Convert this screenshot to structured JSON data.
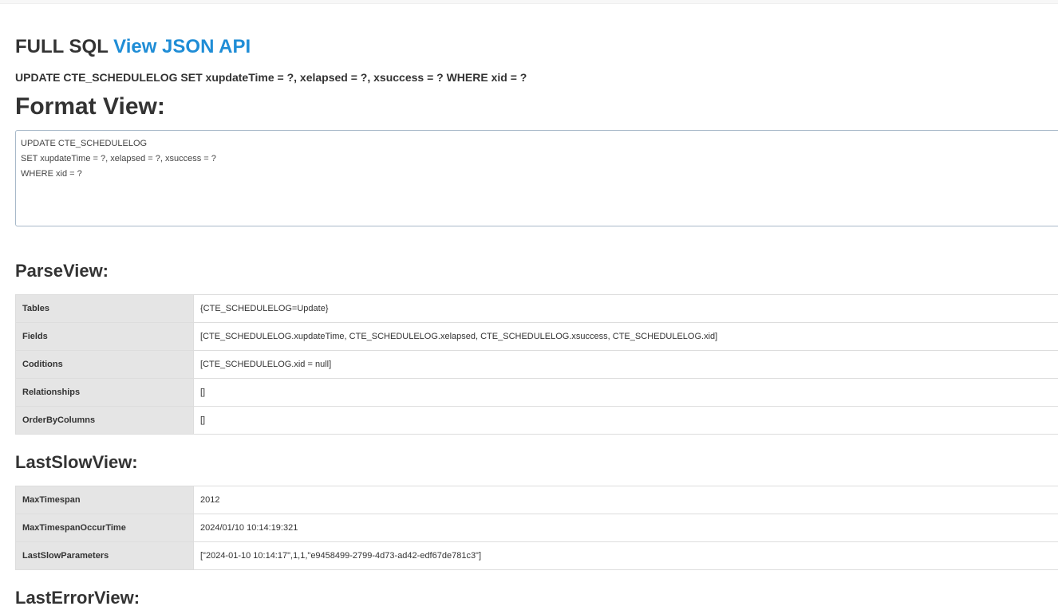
{
  "header": {
    "title": "FULL SQL",
    "json_link": "View JSON API",
    "sql": "UPDATE CTE_SCHEDULELOG SET xupdateTime = ?, xelapsed = ?, xsuccess = ? WHERE xid = ?"
  },
  "format_view": {
    "heading": "Format View:",
    "lines": [
      "UPDATE CTE_SCHEDULELOG",
      "SET xupdateTime = ?, xelapsed = ?, xsuccess = ?",
      "WHERE xid = ?"
    ]
  },
  "parse_view": {
    "heading": "ParseView:",
    "rows": [
      {
        "key": "Tables",
        "value": "{CTE_SCHEDULELOG=Update}"
      },
      {
        "key": "Fields",
        "value": "[CTE_SCHEDULELOG.xupdateTime, CTE_SCHEDULELOG.xelapsed, CTE_SCHEDULELOG.xsuccess, CTE_SCHEDULELOG.xid]"
      },
      {
        "key": "Coditions",
        "value": "[CTE_SCHEDULELOG.xid = null]"
      },
      {
        "key": "Relationships",
        "value": "[]"
      },
      {
        "key": "OrderByColumns",
        "value": "[]"
      }
    ]
  },
  "last_slow_view": {
    "heading": "LastSlowView:",
    "rows": [
      {
        "key": "MaxTimespan",
        "value": "2012"
      },
      {
        "key": "MaxTimespanOccurTime",
        "value": "2024/01/10 10:14:19:321"
      },
      {
        "key": "LastSlowParameters",
        "value": "[\"2024-01-10 10:14:17\",1,1,\"e9458499-2799-4d73-ad42-edf67de781c3\"]"
      }
    ]
  },
  "last_error_view": {
    "heading": "LastErrorView:"
  }
}
